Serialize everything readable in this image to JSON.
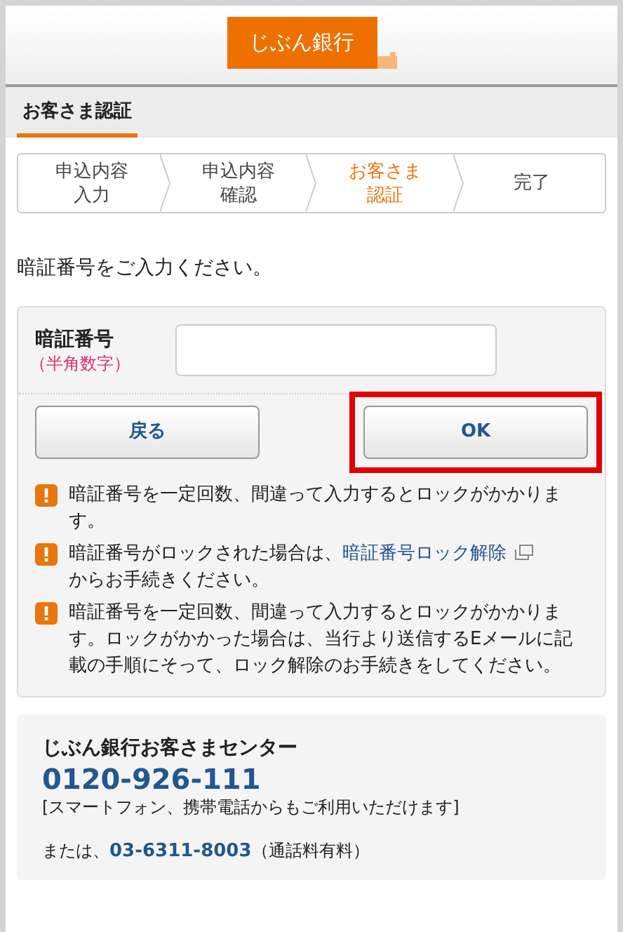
{
  "logo": {
    "text": "じぶん銀行"
  },
  "page_title": "お客さま認証",
  "steps": [
    {
      "label": "申込内容入力",
      "selected": false
    },
    {
      "label": "申込内容確認",
      "selected": false
    },
    {
      "label": "お客さま認証",
      "selected": true
    },
    {
      "label": "完了",
      "selected": false
    }
  ],
  "instruction": "暗証番号をご入力ください。",
  "form": {
    "label": "暗証番号",
    "hint": "（半角数字）",
    "buttons": [
      {
        "label": "戻る",
        "highlighted": false
      },
      {
        "label": "OK",
        "highlighted": true
      }
    ],
    "notes": [
      {
        "text": "暗証番号を一定回数、間違って入力するとロックがかかります。"
      },
      {
        "text": "暗証番号がロックされた場合は、",
        "link": "暗証番号ロック解除",
        "after": "からお手続きください。"
      },
      {
        "text": "暗証番号を一定回数、間違って入力するとロックがかかります。ロックがかかった場合は、当行より送信するEメールに記載の手順にそって、ロック解除のお手続きをしてください。"
      }
    ]
  },
  "support": {
    "title": "じぶん銀行お客さまセンター",
    "phone": "0120-926-111",
    "phone_note": "[スマートフォン、携帯電話からもご利用いただけます]",
    "alt_prefix": "または、",
    "alt_phone": "03-6311-8003",
    "alt_note": "（通話料有料）"
  }
}
